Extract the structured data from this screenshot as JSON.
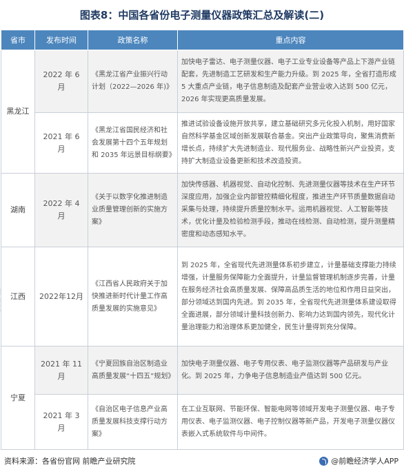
{
  "title": "图表8：中国各省份电子测量仪器政策汇总及解读(二)",
  "table": {
    "headers": [
      "省市",
      "发布时间",
      "政策名称",
      "重点内容"
    ],
    "groups": [
      {
        "province": "黑龙江",
        "rows": [
          {
            "date": "2022 年 6 月",
            "name": "《黑龙江省产业振兴行动计划（2022—2026 年)》",
            "content": "加快电子雷达、电子测量仪器、电子工业专业设备等产品上下游产业链配套，先进制造工艺研发和生产能力升级。到 2025 年，全省打造形成 5 大重点产业链，电子信息制造及配套产业营业收入达到 500 亿元，2026 年实现更高质量发展。"
          },
          {
            "date": "2021 年 6 月",
            "name": "《黑龙江省国民经济和社会发展第十四个五年规划和 2035 年远景目标纲要》",
            "content": "推进试验设备设施开放共享，建立基础研究多元化投入机制，用好国家自然科学基金区域创新发展联合基金。突出产业政策导向，聚焦消费新增长点，持续扩大先进制造业、现代服务业、战略性新兴产业投资，支持扩大制造业设备更新和技术改造投资。"
          }
        ]
      },
      {
        "province": "湖南",
        "rows": [
          {
            "date": "2022 年 4 月",
            "name": "《关于以数字化推进制造业质量管理创新的实施方案》",
            "content": "加快传感器、机器视觉、自动化控制、先进测量仪器等技术在生产环节深度应用，加强企业内部管控精细化程度，推进生产环节质量数据自动采集与处理，持续提升质量控制水平。运用机器视觉、人工智能等技术，优化计量及检验检测手段，推动在线检测、自动检测，提升测量精密度和动态感知水平。"
          }
        ]
      },
      {
        "province": "江西",
        "rows": [
          {
            "date": "2022年12月",
            "name": "《江西省人民政府关于加快推进新时代计量工作高质量发展的实施意见》",
            "content": "到 2025 年，全省现代先进测量体系初步建立，计量基础支撑能力持续增强，计量服务保障能力全面提升，计量监督管理机制逐步完善，计量在服务经济社会高质量发展、保障高品质生活的地位和作用日益突出，部分领域达到国内先进。到 2035 年，全省现代先进测量体系建设取得全面进展，部分领域计量科技创新力、影响力达到国内领先，现代化计量治理能力和治理体系更加健全，民生计量得到充分保障。"
          }
        ]
      },
      {
        "province": "宁夏",
        "rows": [
          {
            "date": "2021 年 11 月",
            "name": "《宁夏回族自治区制造业高质量发展“十四五”规划》",
            "content": "加快电子测量仪器、电子专用仪表、电子监测仪器等产品研发与产业化。到 2025 年，力争电子信息制造业产值达到 500 亿元。"
          },
          {
            "date": "2021 年 3 月",
            "name": "《自治区电子信息产业高质量发展科技支撑行动方案》",
            "content": "在工业互联网、节能环保、智能电网等领域开发电子测量仪器、电子专用仪表、电子监测仪器、电子控制仪器等新产品，开发电子测量仪器仪表嵌入式系统软件与中间件。"
          }
        ]
      }
    ]
  },
  "footer": {
    "source": "资料来源：各省份官网 前瞻产业研究院",
    "brand": "@前瞻经济学人APP"
  },
  "watermark": "前瞻产业研究院"
}
